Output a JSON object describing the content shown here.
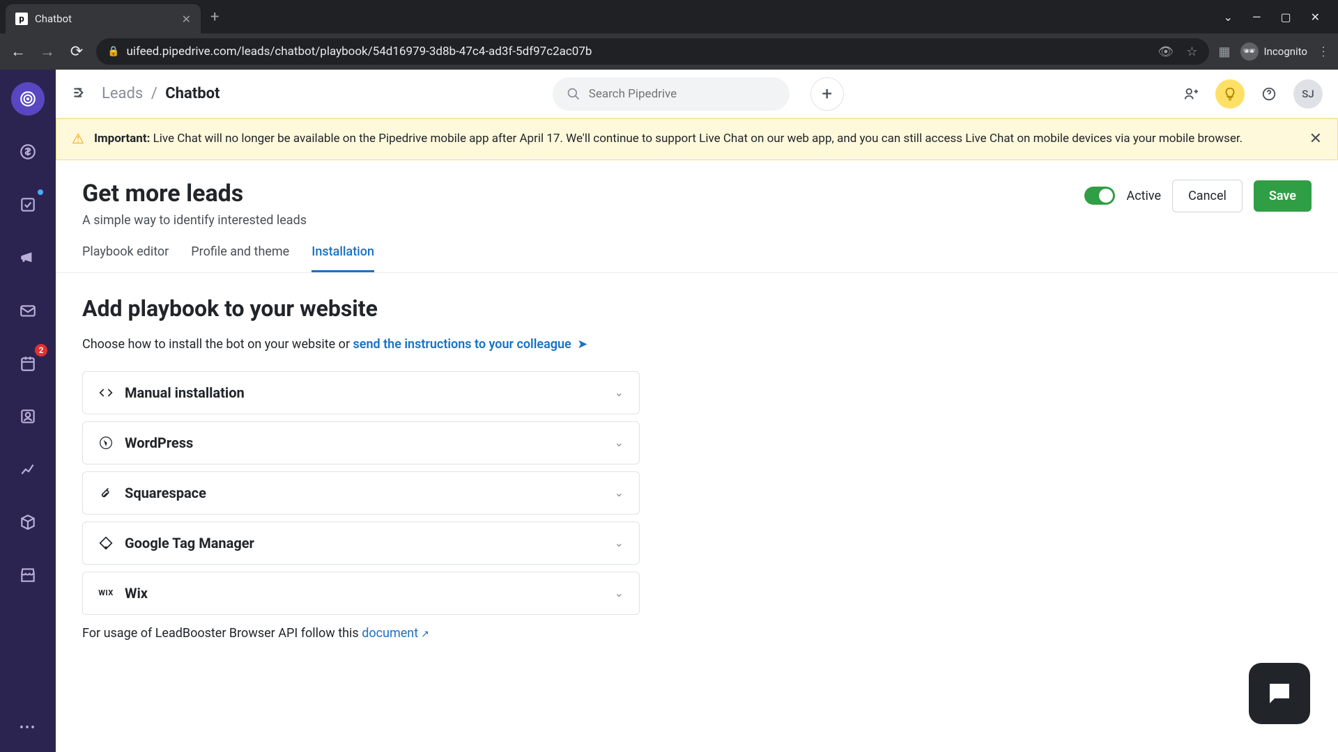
{
  "browser": {
    "tab_title": "Chatbot",
    "url": "uifeed.pipedrive.com/leads/chatbot/playbook/54d16979-3d8b-47c4-ad3f-5df97c2ac07b",
    "incognito_label": "Incognito"
  },
  "sidebar": {
    "badge_count": "2"
  },
  "topbar": {
    "breadcrumb_parent": "Leads",
    "breadcrumb_current": "Chatbot",
    "search_placeholder": "Search Pipedrive",
    "avatar_initials": "SJ"
  },
  "alert": {
    "prefix": "Important:",
    "message": " Live Chat will no longer be available on the Pipedrive mobile app after April 17. We'll continue to support Live Chat on our web app, and you can still access Live Chat on mobile devices via your mobile browser."
  },
  "header": {
    "title": "Get more leads",
    "subtitle": "A simple way to identify interested leads",
    "toggle_label": "Active",
    "cancel_label": "Cancel",
    "save_label": "Save"
  },
  "tabs": {
    "items": [
      "Playbook editor",
      "Profile and theme",
      "Installation"
    ],
    "active_index": 2
  },
  "section": {
    "heading": "Add playbook to your website",
    "desc_prefix": "Choose how to install the bot on your website or ",
    "desc_link": "send the instructions to your colleague"
  },
  "accordion": {
    "items": [
      {
        "label": "Manual installation"
      },
      {
        "label": "WordPress"
      },
      {
        "label": "Squarespace"
      },
      {
        "label": "Google Tag Manager"
      },
      {
        "label": "Wix"
      }
    ]
  },
  "api_note": {
    "prefix": "For usage of LeadBooster Browser API follow this ",
    "link": "document"
  }
}
